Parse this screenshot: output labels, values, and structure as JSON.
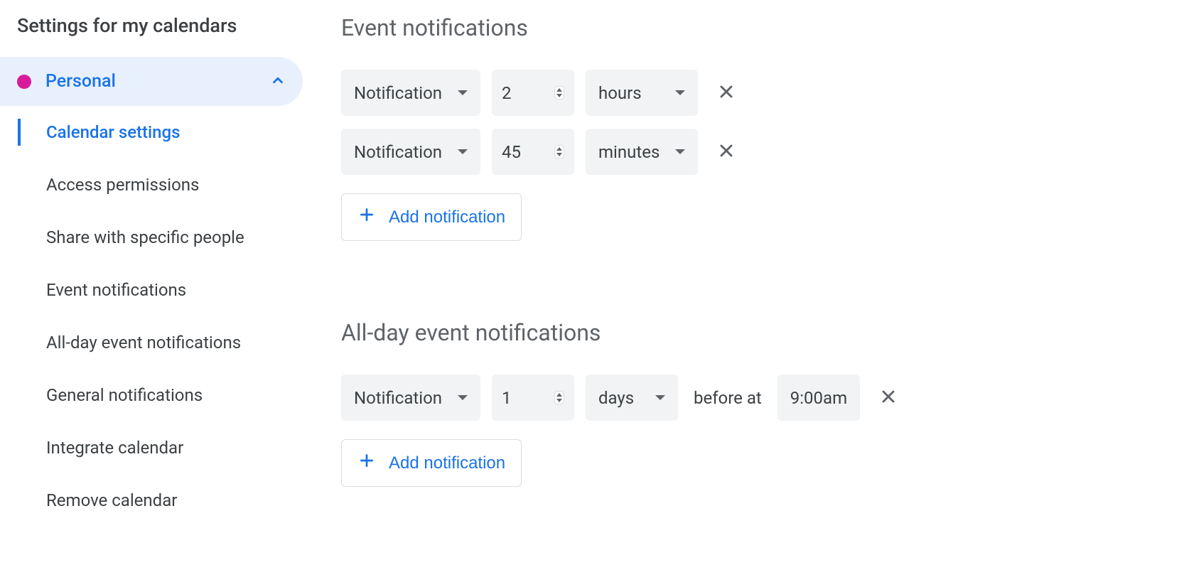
{
  "sidebar": {
    "title": "Settings for my calendars",
    "calendar": {
      "name": "Personal",
      "color": "#d81b9b"
    },
    "nav": [
      {
        "label": "Calendar settings",
        "active": true
      },
      {
        "label": "Access permissions",
        "active": false
      },
      {
        "label": "Share with specific people",
        "active": false
      },
      {
        "label": "Event notifications",
        "active": false
      },
      {
        "label": "All-day event notifications",
        "active": false
      },
      {
        "label": "General notifications",
        "active": false
      },
      {
        "label": "Integrate calendar",
        "active": false
      },
      {
        "label": "Remove calendar",
        "active": false
      }
    ]
  },
  "main": {
    "event_notifications": {
      "title": "Event notifications",
      "rows": [
        {
          "type": "Notification",
          "value": "2",
          "unit": "hours"
        },
        {
          "type": "Notification",
          "value": "45",
          "unit": "minutes"
        }
      ],
      "add_label": "Add notification"
    },
    "allday_notifications": {
      "title": "All-day event notifications",
      "rows": [
        {
          "type": "Notification",
          "value": "1",
          "unit": "days",
          "before_text": "before at",
          "time": "9:00am"
        }
      ],
      "add_label": "Add notification"
    }
  }
}
